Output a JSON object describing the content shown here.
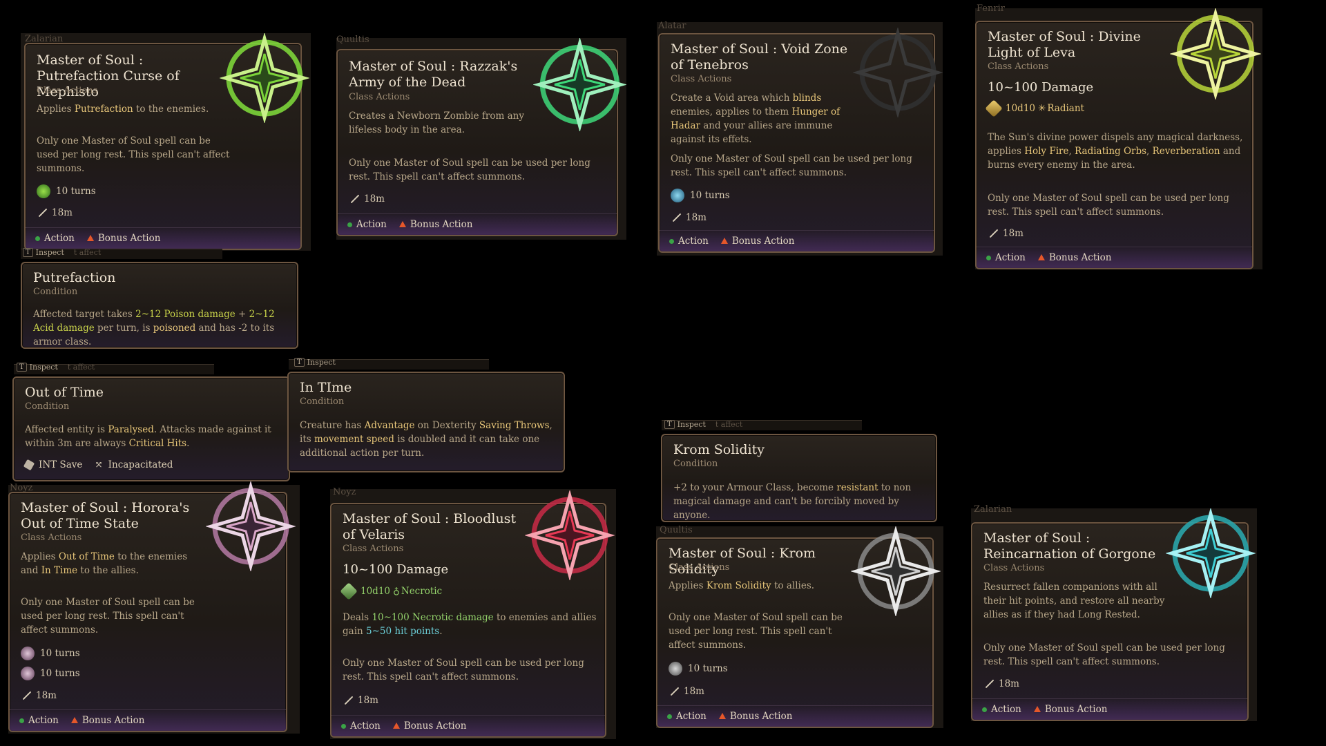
{
  "common": {
    "class_actions": "Class Actions",
    "condition": "Condition",
    "once_text": "Only one Master of Soul spell can be used per long rest. This spell can't affect summons.",
    "range": "18m",
    "action": "Action",
    "bonus_action": "Bonus Action",
    "inspect": "Inspect",
    "inspect_key": "T",
    "ghost_text": "t affect",
    "turns10": "10 turns"
  },
  "cards": {
    "mephisto": {
      "owner": "Zalarian",
      "title": "Master of Soul : Putrefaction Curse of Mephisto",
      "desc_prefix": "Applies ",
      "desc_link": "Putrefaction",
      "desc_suffix": " to the enemies.",
      "sigil_color": "#7cd43a"
    },
    "razzak": {
      "owner": "Quultis",
      "title": "Master of Soul : Razzak's Army of the Dead",
      "desc": "Creates a Newborn Zombie from any lifeless body in the area.",
      "sigil_color": "#3ed87a"
    },
    "void": {
      "owner": "Alatar",
      "title": "Master of Soul : Void Zone of Tenebros",
      "desc_a": "Create a Void area which ",
      "desc_b": "blinds",
      "desc_c": " enemies, applies to them ",
      "desc_d": "Hunger of Hadar",
      "desc_e": " and your allies are immune against its effets.",
      "sigil_color": "#2a2a2a"
    },
    "leva": {
      "owner": "Fenrir",
      "title": "Master of Soul : Divine Light of Leva",
      "damage": "10~100 Damage",
      "dice": "10d10",
      "dmg_type": "Radiant",
      "desc_a": "The Sun's divine power dispels any magical darkness, applies ",
      "desc_b": "Holy Fire",
      "desc_c": ", ",
      "desc_d": "Radiating Orbs",
      "desc_e": ", ",
      "desc_f": "Reverberation",
      "desc_g": " and burns every enemy in the area.",
      "sigil_color": "#b9d63a"
    },
    "putrefaction": {
      "title": "Putrefaction",
      "desc_a": "Affected target takes ",
      "desc_b": "2~12 Poison damage",
      "desc_c": " + ",
      "desc_d": "2~12 Acid damage",
      "desc_e": " per turn, is ",
      "desc_f": "poisoned",
      "desc_g": " and has -2 to its armor class."
    },
    "outoftime": {
      "title": "Out of Time",
      "desc_a": "Affected entity is ",
      "desc_b": "Paralysed",
      "desc_c": ". Attacks made against it within 3m are always ",
      "desc_d": "Critical Hits",
      "desc_e": ".",
      "save": "INT Save",
      "status": "Incapacitated"
    },
    "intime": {
      "title": "In TIme",
      "desc_a": "Creature has ",
      "desc_b": "Advantage",
      "desc_c": " on Dexterity ",
      "desc_d": "Saving Throws",
      "desc_e": ", its ",
      "desc_f": "movement speed",
      "desc_g": " is doubled and it can take one additional action per turn."
    },
    "krom_cond": {
      "title": "Krom Solidity",
      "desc_a": "+2 to your Armour Class, become ",
      "desc_b": "resistant",
      "desc_c": " to non magical damage and can't be forcibly moved by anyone."
    },
    "horora": {
      "owner": "Noyz",
      "title": "Master of Soul : Horora's Out of Time State",
      "desc_a": "Applies ",
      "desc_b": "Out of Time",
      "desc_c": " to the enemies and ",
      "desc_d": "In Time",
      "desc_e": " to the allies.",
      "sigil_color": "#d9a6c8"
    },
    "velaris": {
      "owner": "Noyz",
      "title": "Master of Soul : Bloodlust of Velaris",
      "damage": "10~100 Damage",
      "dice": "10d10",
      "dmg_type": "Necrotic",
      "desc_a": "Deals ",
      "desc_b": "10~100 Necrotic damage",
      "desc_c": " to enemies and allies gain ",
      "desc_d": "5~50 hit points",
      "desc_e": ".",
      "sigil_color": "#e83a55"
    },
    "krom": {
      "owner": "Quultis",
      "title": "Master of Soul : Krom Solidity",
      "desc_a": "Applies ",
      "desc_b": "Krom Solidity",
      "desc_c": " to allies.",
      "sigil_color": "#cfcfcf"
    },
    "gorgone": {
      "owner": "Zalarian",
      "title": "Master of Soul : Reincarnation of Gorgone",
      "desc": "Resurrect fallen companions with all their hit points, and restore all nearby allies as if they had Long Rested.",
      "sigil_color": "#3fd0d6"
    }
  }
}
